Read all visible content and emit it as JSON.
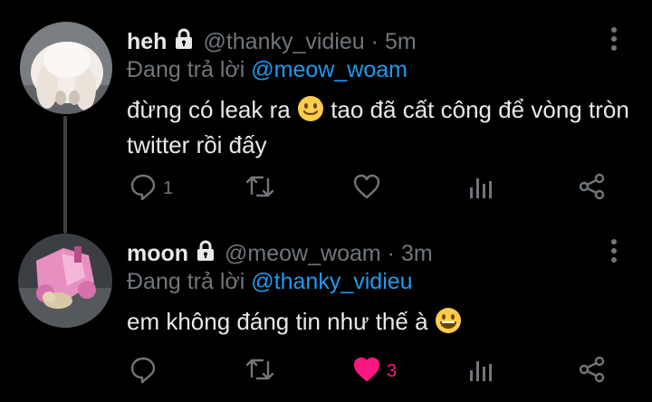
{
  "tweets": [
    {
      "name": "heh",
      "handle": "@thanky_vidieu",
      "separator": "·",
      "time": "5m",
      "reply_prefix": "Đang trả lời",
      "reply_to": "@meow_woam",
      "text_part1": "đừng có leak ra",
      "text_part2": "tao đã cất công để vòng tròn twitter rồi đấy",
      "emoji": "slightly-smiling-face",
      "reply_count": "1",
      "like_count": "",
      "liked": false
    },
    {
      "name": "moon",
      "handle": "@meow_woam",
      "separator": "·",
      "time": "3m",
      "reply_prefix": "Đang trả lời",
      "reply_to": "@thanky_vidieu",
      "text_part1": "em không đáng tin như thế à",
      "emoji": "grinning-face",
      "reply_count": "",
      "like_count": "3",
      "liked": true
    }
  ],
  "icons": [
    "lock-icon",
    "more-icon",
    "reply-icon",
    "retweet-icon",
    "like-icon",
    "views-icon",
    "share-icon"
  ],
  "colors": {
    "background": "#000000",
    "text": "#e7e9ea",
    "secondary": "#71767b",
    "mention": "#1d9bf0",
    "like": "#f91880",
    "thread_line": "#3e4144"
  }
}
